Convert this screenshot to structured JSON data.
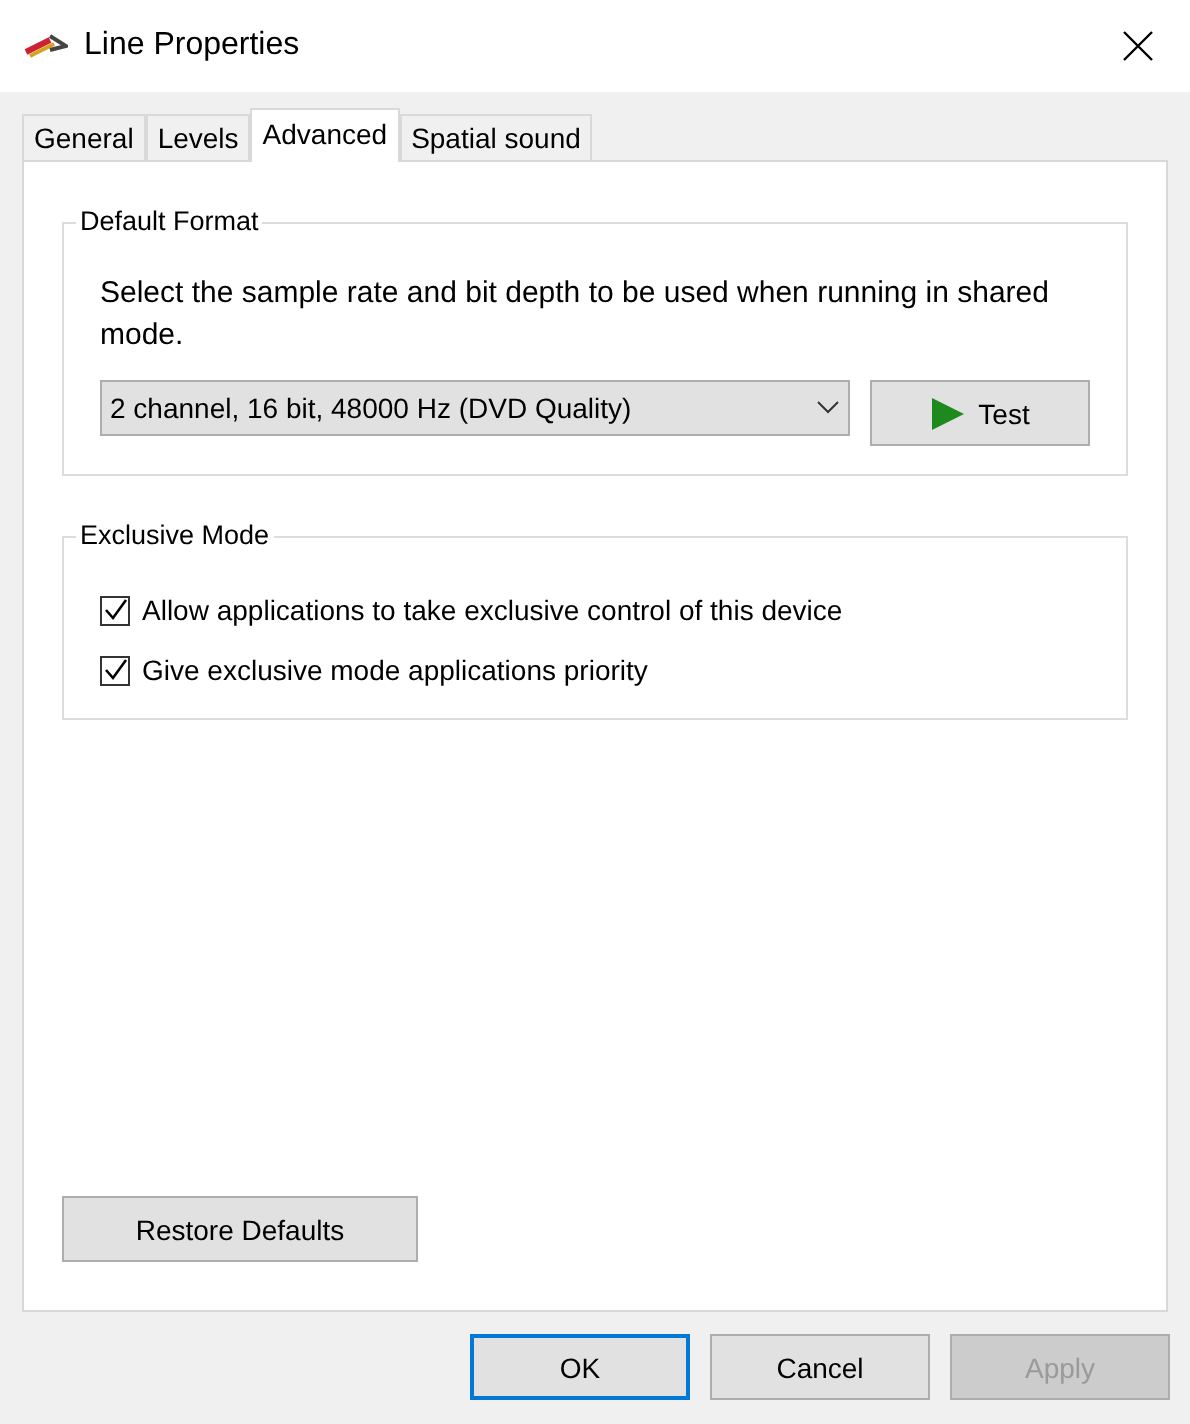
{
  "window": {
    "title": "Line Properties"
  },
  "tabs": [
    {
      "label": "General",
      "selected": false
    },
    {
      "label": "Levels",
      "selected": false
    },
    {
      "label": "Advanced",
      "selected": true
    },
    {
      "label": "Spatial sound",
      "selected": false
    }
  ],
  "default_format": {
    "title": "Default Format",
    "description": "Select the sample rate and bit depth to be used when running in shared mode.",
    "format": "2 channel, 16 bit, 48000 Hz (DVD Quality)",
    "test_button": "Test"
  },
  "exclusive_mode": {
    "title": "Exclusive Mode",
    "options": [
      {
        "label": "Allow applications to take exclusive control of this device",
        "checked": true
      },
      {
        "label": "Give exclusive mode applications priority",
        "checked": true
      }
    ]
  },
  "restore_button": "Restore Defaults",
  "buttons": [
    {
      "label": "OK",
      "default": true,
      "disabled": false
    },
    {
      "label": "Cancel",
      "default": false,
      "disabled": false
    },
    {
      "label": "Apply",
      "default": false,
      "disabled": true
    }
  ]
}
